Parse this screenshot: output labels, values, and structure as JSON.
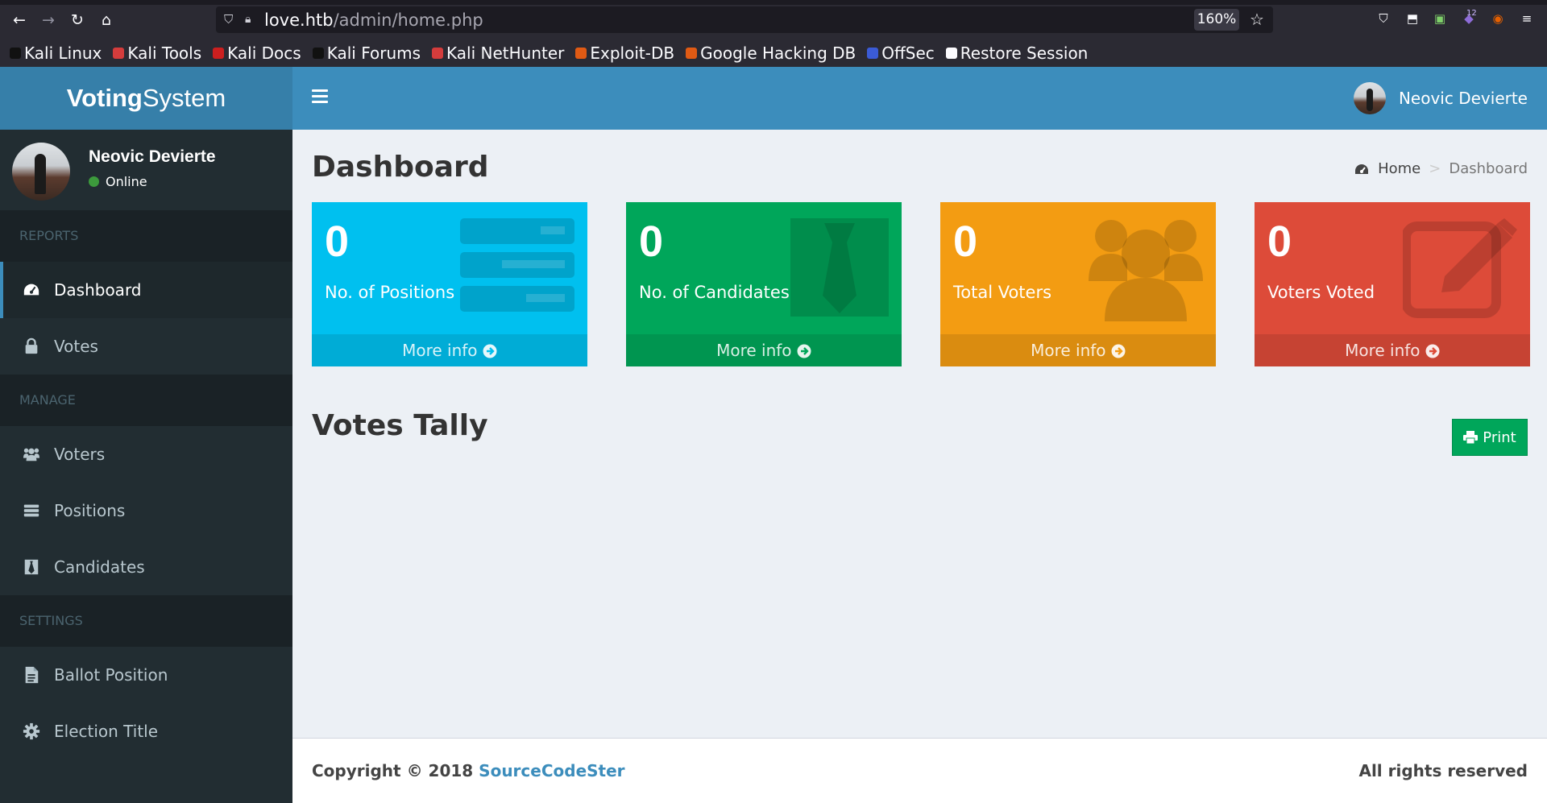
{
  "browser": {
    "url_host": "love.htb",
    "url_path": "/admin/home.php",
    "zoom": "160%",
    "bookmarks": [
      {
        "label": "Kali Linux",
        "color": "#111111"
      },
      {
        "label": "Kali Tools",
        "color": "#d43c3c"
      },
      {
        "label": "Kali Docs",
        "color": "#cc1f1f"
      },
      {
        "label": "Kali Forums",
        "color": "#111111"
      },
      {
        "label": "Kali NetHunter",
        "color": "#d43c3c"
      },
      {
        "label": "Exploit-DB",
        "color": "#e05a14"
      },
      {
        "label": "Google Hacking DB",
        "color": "#e05a14"
      },
      {
        "label": "OffSec",
        "color": "#3b5bd6"
      },
      {
        "label": "Restore Session",
        "color": "#fbfbfe"
      }
    ],
    "extension_badge": "12"
  },
  "app": {
    "logo_bold": "Voting",
    "logo_rest": "System",
    "user_name": "Neovic Devierte",
    "user_status": "Online"
  },
  "sidebar": {
    "sections": [
      {
        "header": "REPORTS",
        "items": [
          {
            "label": "Dashboard",
            "icon": "dashboard-icon",
            "active": true
          },
          {
            "label": "Votes",
            "icon": "lock-icon",
            "active": false
          }
        ]
      },
      {
        "header": "MANAGE",
        "items": [
          {
            "label": "Voters",
            "icon": "users-icon",
            "active": false
          },
          {
            "label": "Positions",
            "icon": "tasks-icon",
            "active": false
          },
          {
            "label": "Candidates",
            "icon": "tie-icon",
            "active": false
          }
        ]
      },
      {
        "header": "SETTINGS",
        "items": [
          {
            "label": "Ballot Position",
            "icon": "file-text-icon",
            "active": false
          },
          {
            "label": "Election Title",
            "icon": "cog-icon",
            "active": false
          }
        ]
      }
    ]
  },
  "header": {
    "user_name": "Neovic Devierte"
  },
  "content": {
    "page_title": "Dashboard",
    "breadcrumb_home": "Home",
    "breadcrumb_sep": ">",
    "breadcrumb_current": "Dashboard",
    "boxes": [
      {
        "number": "0",
        "label": "No. of Positions",
        "more": "More info",
        "color": "#00c0ef",
        "icon": "tasks-icon"
      },
      {
        "number": "0",
        "label": "No. of Candidates",
        "more": "More info",
        "color": "#00a65a",
        "icon": "tie-icon"
      },
      {
        "number": "0",
        "label": "Total Voters",
        "more": "More info",
        "color": "#f39c12",
        "icon": "users-icon"
      },
      {
        "number": "0",
        "label": "Voters Voted",
        "more": "More info",
        "color": "#dd4b39",
        "icon": "edit-icon"
      }
    ],
    "tally_title": "Votes Tally",
    "print_label": "Print"
  },
  "footer": {
    "copyright_prefix": "Copyright © 2018",
    "copyright_link": "SourceCodeSter",
    "rights": "All rights reserved"
  }
}
